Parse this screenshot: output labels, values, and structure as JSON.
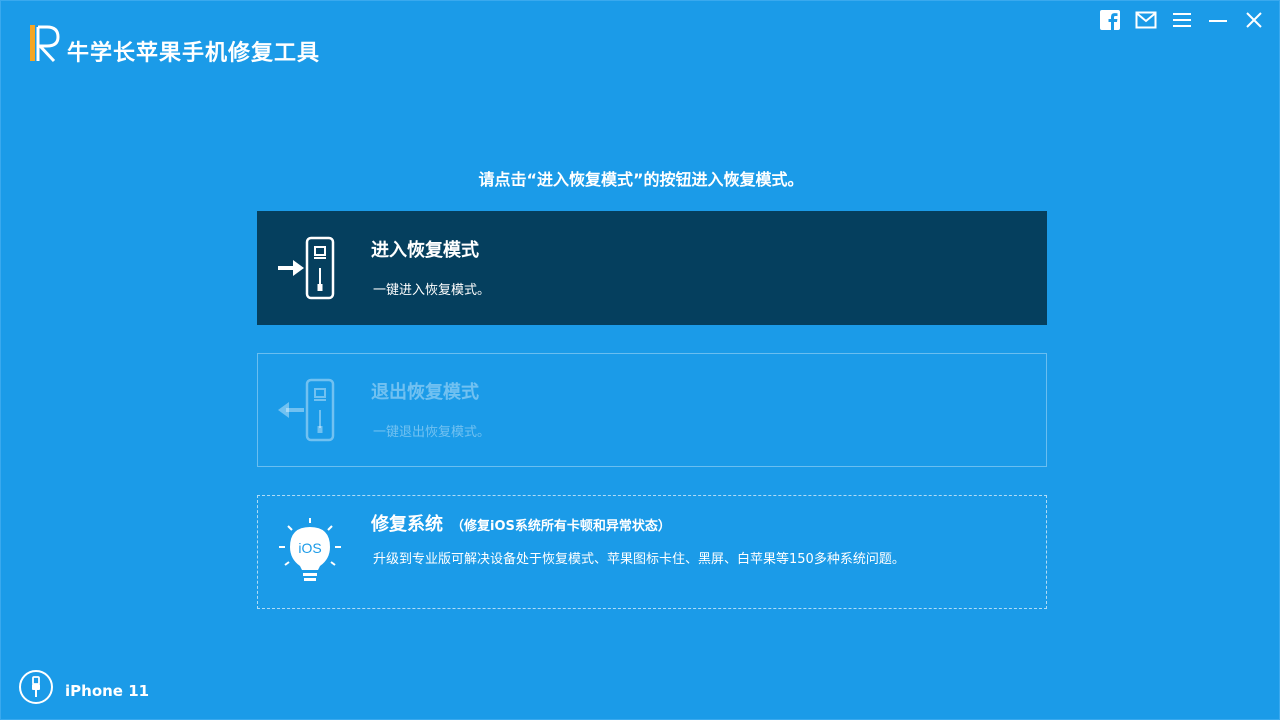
{
  "app": {
    "title": "牛学长苹果手机修复工具"
  },
  "window_controls": [
    {
      "name": "facebook-icon"
    },
    {
      "name": "mail-icon"
    },
    {
      "name": "menu-icon"
    },
    {
      "name": "minimize-icon"
    },
    {
      "name": "close-icon"
    }
  ],
  "main": {
    "instruction": "请点击“进入恢复模式”的按钮进入恢复模式。",
    "options": {
      "enter": {
        "title": "进入恢复模式",
        "subtitle": "一键进入恢复模式。",
        "icon": "phone-enter-icon",
        "state": "active"
      },
      "exit": {
        "title": "退出恢复模式",
        "subtitle": "一键退出恢复模式。",
        "icon": "phone-exit-icon",
        "state": "disabled"
      },
      "repair": {
        "title": "修复系统",
        "note": "（修复iOS系统所有卡顿和异常状态）",
        "subtitle": "升级到专业版可解决设备处于恢复模式、苹果图标卡住、黑屏、白苹果等150多种系统问题。",
        "icon": "ios-lightbulb-icon",
        "badge": "iOS"
      }
    }
  },
  "footer": {
    "device_name": "iPhone 11",
    "device_icon": "usb-cable-icon"
  },
  "colors": {
    "background": "#1b9be8",
    "active_card": "#053f5e",
    "text": "#ffffff"
  }
}
